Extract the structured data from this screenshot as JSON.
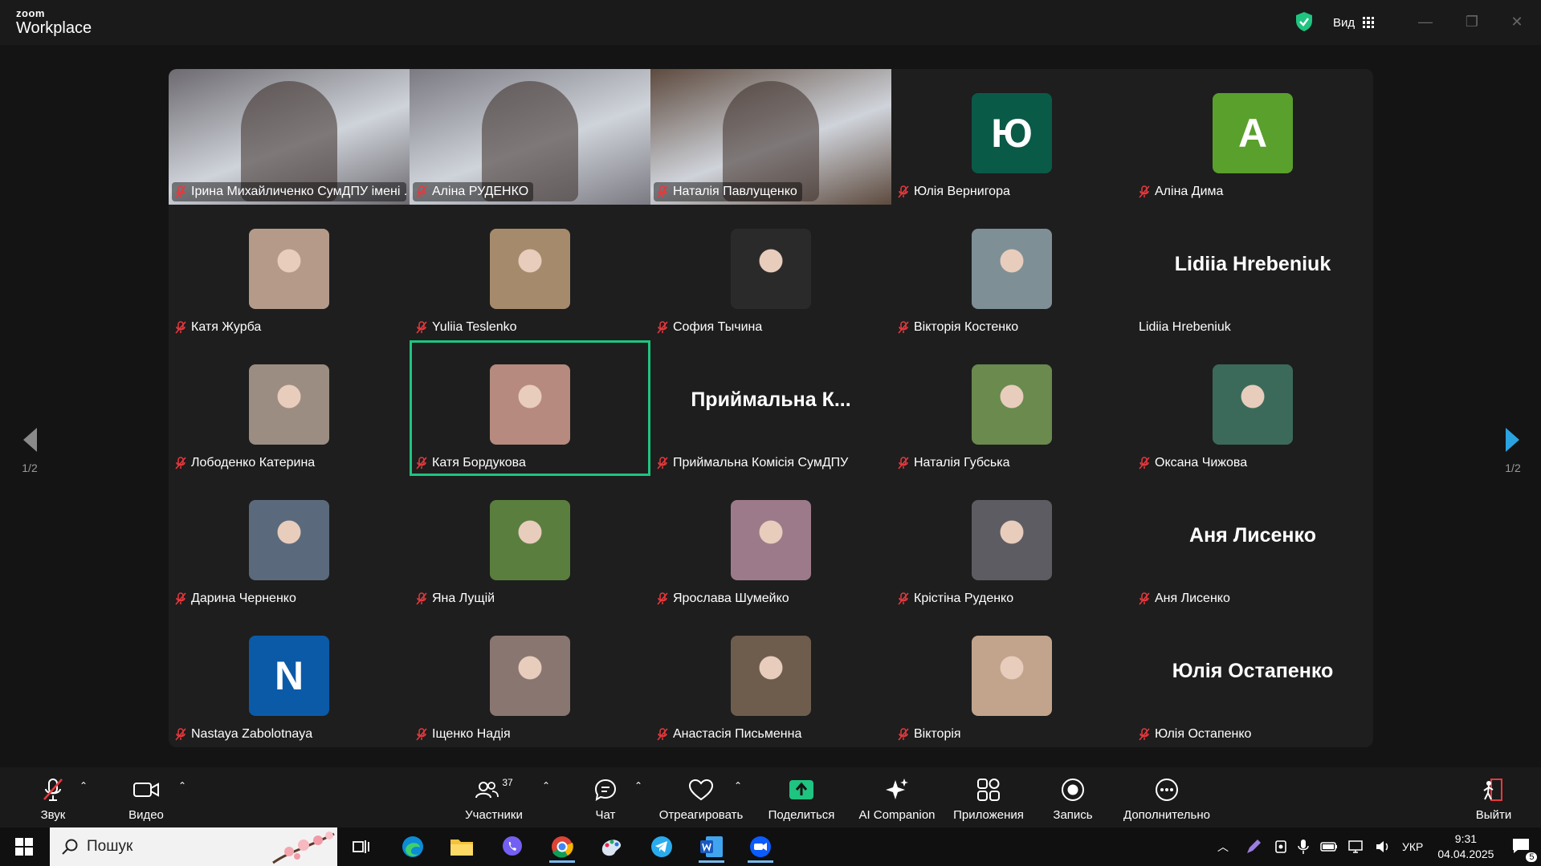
{
  "app": {
    "brand_top": "zoom",
    "brand_bottom": "Workplace"
  },
  "titlebar": {
    "view_label": "Вид"
  },
  "gallery": {
    "page_indicator_left": "1/2",
    "page_indicator_right": "1/2",
    "participants": [
      {
        "name": "Ірина Михайличенко СумДПУ імені ...",
        "kind": "video",
        "color": "#6d6a70"
      },
      {
        "name": "Аліна РУДЕНКО",
        "kind": "video",
        "color": "#7b7a82"
      },
      {
        "name": "Наталія Павлущенко",
        "kind": "video",
        "color": "#5d4a3e"
      },
      {
        "name": "Юлія Вернигора",
        "kind": "letter",
        "letter": "Ю",
        "color": "#0a5a48"
      },
      {
        "name": "Аліна Дима",
        "kind": "letter",
        "letter": "А",
        "color": "#5aa02c"
      },
      {
        "name": "Катя Журба",
        "kind": "photo",
        "color": "#b59a8a"
      },
      {
        "name": "Yuliia Teslenko",
        "kind": "photo",
        "color": "#a58b6c"
      },
      {
        "name": "София Тычина",
        "kind": "photo",
        "color": "#2a2a2a"
      },
      {
        "name": "Вікторія Костенко",
        "kind": "photo",
        "color": "#7e8f96"
      },
      {
        "name": "Lidiia Hrebeniuk",
        "kind": "text",
        "display": "Lidiia Hrebeniuk"
      },
      {
        "name": "Лободенко Катерина",
        "kind": "photo",
        "color": "#9c8d82"
      },
      {
        "name": "Катя Бордукова",
        "kind": "photo",
        "color": "#b68a7e",
        "active": true
      },
      {
        "name": "Приймальна Комісія СумДПУ",
        "kind": "text",
        "display": "Приймальна К..."
      },
      {
        "name": "Наталія Губська",
        "kind": "photo",
        "color": "#6a8a4e"
      },
      {
        "name": "Оксана Чижова",
        "kind": "photo",
        "color": "#3c6a5a"
      },
      {
        "name": "Дарина Черненко",
        "kind": "photo",
        "color": "#5a6a7c"
      },
      {
        "name": "Яна Лущій",
        "kind": "photo",
        "color": "#5a7e3e"
      },
      {
        "name": "Ярослава Шумейко",
        "kind": "photo",
        "color": "#9c7a8a"
      },
      {
        "name": "Крістіна Руденко",
        "kind": "photo",
        "color": "#5c5c62"
      },
      {
        "name": "Аня Лисенко",
        "kind": "text",
        "display": "Аня Лисенко"
      },
      {
        "name": "Nastaya Zabolotnaya",
        "kind": "letter",
        "letter": "N",
        "color": "#0b5aa8"
      },
      {
        "name": "Іщенко Надія",
        "kind": "photo",
        "color": "#8a7670"
      },
      {
        "name": "Анастасія Письменна",
        "kind": "photo",
        "color": "#6e5c4c"
      },
      {
        "name": "Вікторія",
        "kind": "photo",
        "color": "#c2a48c"
      },
      {
        "name": "Юлія Остапенко",
        "kind": "text",
        "display": "Юлія Остапенко"
      }
    ]
  },
  "toolbar": {
    "audio_label": "Звук",
    "video_label": "Видео",
    "participants_label": "Участники",
    "participants_count": "37",
    "chat_label": "Чат",
    "react_label": "Отреагировать",
    "share_label": "Поделиться",
    "ai_label": "AI Companion",
    "apps_label": "Приложения",
    "record_label": "Запись",
    "more_label": "Дополнительно",
    "leave_label": "Выйти",
    "share_color": "#1fc480"
  },
  "taskbar": {
    "search_placeholder": "Пошук",
    "language": "УКР",
    "time": "9:31",
    "date": "04.04.2025",
    "notifications": "5"
  }
}
